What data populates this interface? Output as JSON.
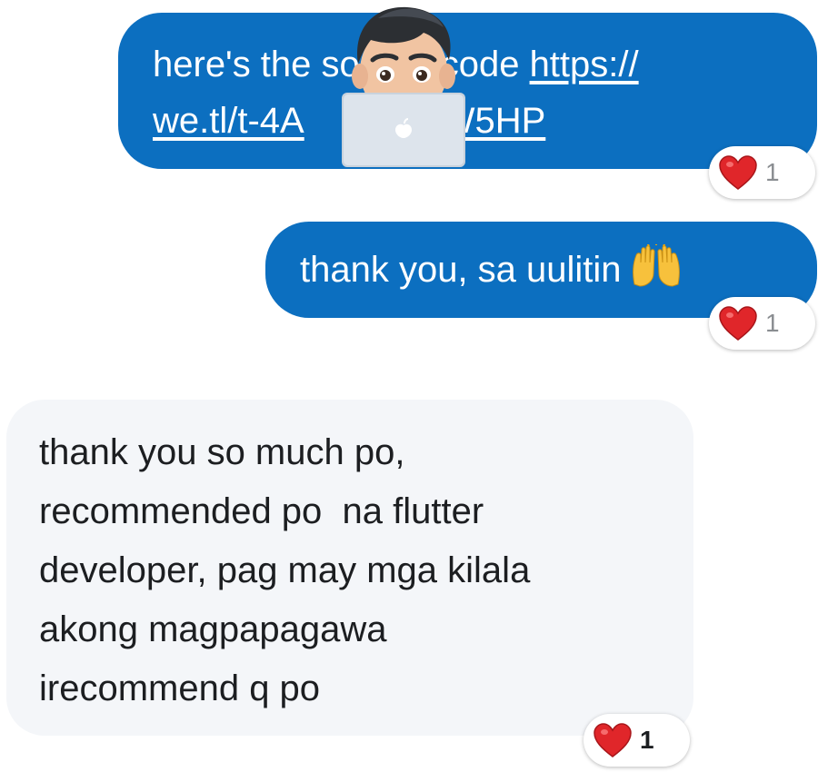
{
  "messages": [
    {
      "direction": "outgoing",
      "lines": [
        "here's the source code ",
        "we.tl/t-4A"
      ],
      "link_line1": "https://",
      "link_line2_tail": "W5HP",
      "reaction": {
        "emoji": "heart",
        "count": "1"
      }
    },
    {
      "direction": "outgoing",
      "text": "thank you, sa uulitin",
      "trailing_emoji": "raised-hands",
      "reaction": {
        "emoji": "heart",
        "count": "1"
      }
    },
    {
      "direction": "incoming",
      "lines": [
        "thank you so much po,",
        "recommended po  na flutter",
        "developer, pag may mga kilala",
        "akong magpapagawa",
        "irecommend q po"
      ],
      "reaction": {
        "emoji": "heart",
        "count": "1"
      }
    }
  ],
  "overlay": {
    "icon": "memoji-laptop-icon"
  },
  "colors": {
    "outgoing_bubble": "#0c6fc0",
    "incoming_bubble": "#f4f6f9",
    "heart": "#e0262a",
    "reaction_count": "#8a8d91"
  }
}
